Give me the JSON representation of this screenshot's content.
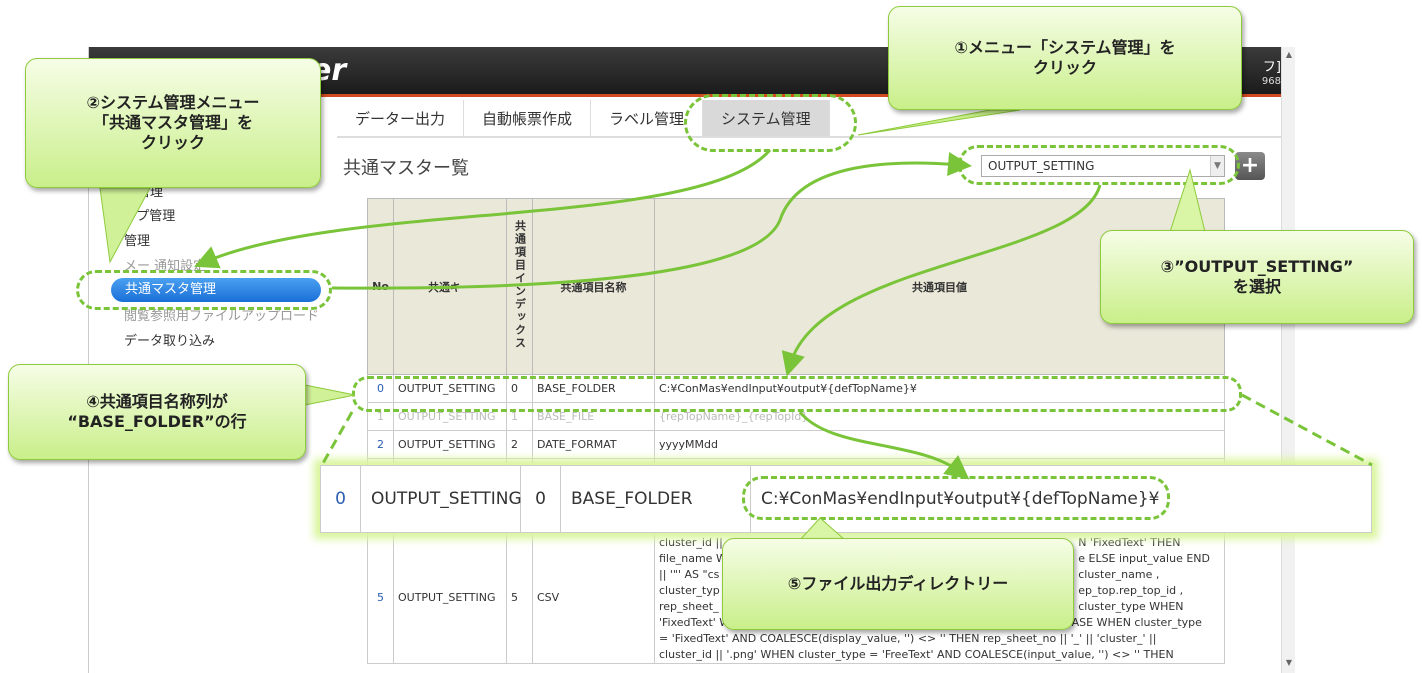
{
  "app": {
    "brand": "er",
    "user_line1": "フ]",
    "user_line2": "968"
  },
  "tabs": [
    {
      "label": "データー出力"
    },
    {
      "label": "自動帳票作成"
    },
    {
      "label": "ラベル管理"
    },
    {
      "label": "システム管理"
    }
  ],
  "sidebar": {
    "items": [
      {
        "label": "ー管理"
      },
      {
        "label": "ープ管理"
      },
      {
        "label": "管理"
      },
      {
        "label": "メー 通知設定"
      },
      {
        "label": "共通マスタ管理"
      },
      {
        "label": "閲覧参照用ファイルアップロード"
      },
      {
        "label": "データ取り込み"
      }
    ]
  },
  "main": {
    "title": "共通マスター覧",
    "select_value": "OUTPUT_SETTING",
    "add_label": "+"
  },
  "table": {
    "headers": {
      "no": "No",
      "key": "共通キー",
      "index": "共通項目インデックス",
      "name": "共通項目名称",
      "value": "共通項目値"
    },
    "rows": [
      {
        "no": "0",
        "key": "OUTPUT_SETTING",
        "index": "0",
        "name": "BASE_FOLDER",
        "value": "C:¥ConMas¥endInput¥output¥{defTopName}¥"
      },
      {
        "no": "1",
        "key": "OUTPUT_SETTING",
        "index": "1",
        "name": "BASE_FILE",
        "value": "{repTopName}_{repTopId}"
      },
      {
        "no": "2",
        "key": "OUTPUT_SETTING",
        "index": "2",
        "name": "DATE_FORMAT",
        "value": "yyyyMMdd"
      }
    ],
    "csv_row": {
      "no": "5",
      "key": "OUTPUT_SETTING",
      "index": "5",
      "name": "CSV",
      "value_lines": [
        "cluster_id ||",
        "file_name W",
        "|| '\"' AS \"cs",
        "cluster_typ",
        "rep_sheet_",
        "'FixedText' WHEN display_value ELSE input_value END || '\"' input_value || CASE WHEN cluster_type",
        "= 'FixedText' AND COALESCE(display_value, '') <> '' THEN rep_sheet_no || '_' || 'cluster_' ||",
        "cluster_id || '.png' WHEN cluster_type = 'FreeText' AND COALESCE(input_value, '') <> '' THEN"
      ],
      "value_right_lines": [
        "N 'FixedText' THEN",
        "e ELSE input_value END",
        "cluster_name ,",
        "ep_top.rep_top_id ,",
        "cluster_type WHEN"
      ]
    }
  },
  "zoom": {
    "no": "0",
    "key": "OUTPUT_SETTING",
    "index": "0",
    "name": "BASE_FOLDER",
    "value": "C:¥ConMas¥endInput¥output¥{defTopName}¥"
  },
  "callouts": {
    "c1": "①メニュー「システム管理」を\nクリック",
    "c2": "②システム管理メニュー\n「共通マスタ管理」を\nクリック",
    "c3": "③”OUTPUT_SETTING”\nを選択",
    "c4": "④共通項目名称列が\n“BASE_FOLDER”の行",
    "c5": "⑤ファイル出力ディレクトリー"
  },
  "colors": {
    "accent_green": "#7ac43a",
    "header_dark": "#2a2a2a",
    "header_accent": "#d24a1f",
    "selected_blue": "#1a6fd8"
  }
}
